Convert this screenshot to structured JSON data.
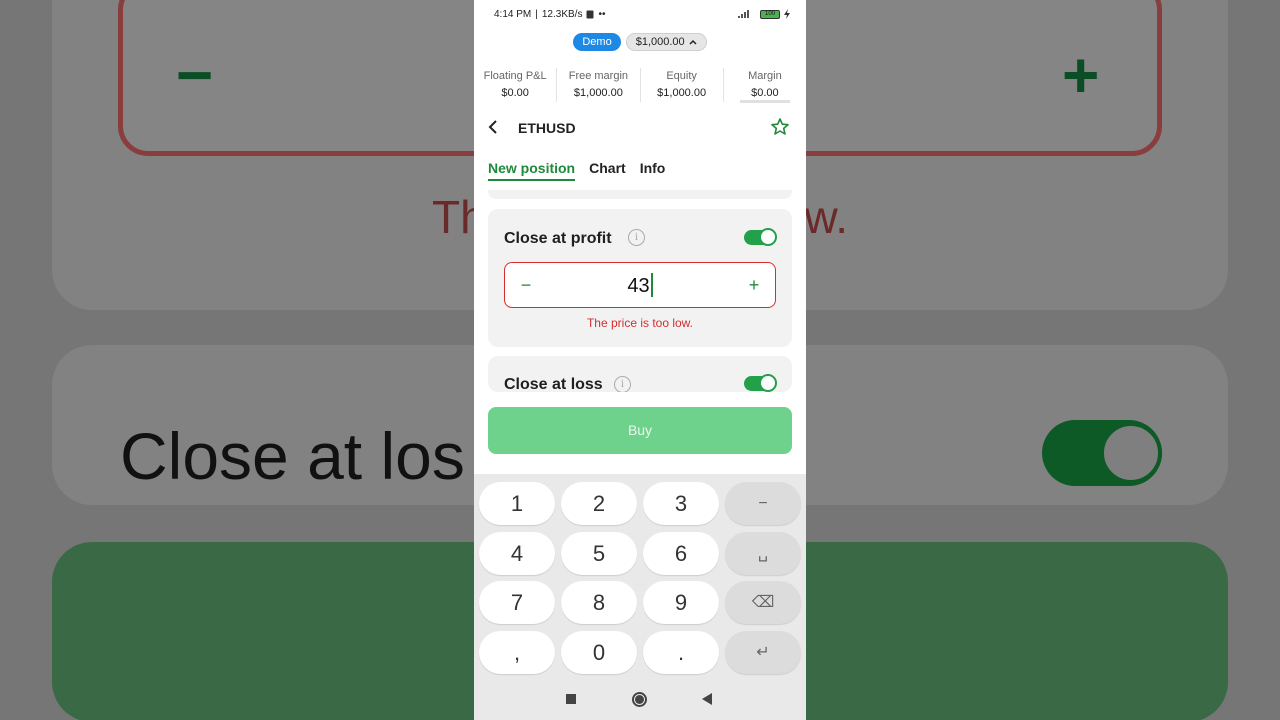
{
  "status_bar": {
    "time": "4:14 PM",
    "speed": "12.3KB/s",
    "extra": "••",
    "battery": "100"
  },
  "account": {
    "mode": "Demo",
    "balance": "$1,000.00"
  },
  "metrics": [
    {
      "label": "Floating P&L",
      "value": "$0.00"
    },
    {
      "label": "Free margin",
      "value": "$1,000.00"
    },
    {
      "label": "Equity",
      "value": "$1,000.00"
    },
    {
      "label": "Margin",
      "value": "$0.00"
    }
  ],
  "header": {
    "symbol": "ETHUSD"
  },
  "tabs": [
    {
      "label": "New position",
      "active": true
    },
    {
      "label": "Chart",
      "active": false
    },
    {
      "label": "Info",
      "active": false
    }
  ],
  "close_at_profit": {
    "title": "Close at profit",
    "enabled": true,
    "minus": "−",
    "plus": "+",
    "value": "43",
    "error": "The price is too low."
  },
  "close_at_loss": {
    "title": "Close at loss",
    "enabled": true
  },
  "buy_button": {
    "label": "Buy"
  },
  "keyboard": {
    "rows": [
      [
        "1",
        "2",
        "3",
        "−"
      ],
      [
        "4",
        "5",
        "6",
        "␣"
      ],
      [
        "7",
        "8",
        "9",
        "⌫"
      ],
      [
        ",",
        "0",
        ".",
        "↵"
      ]
    ]
  },
  "background": {
    "minus": "−",
    "plus": "+",
    "error_fragment_left": "Th",
    "error_fragment_right": "w.",
    "loss_fragment": "Close at los"
  },
  "colors": {
    "accent_green": "#1f8a3b",
    "error_red": "#d32f2f",
    "demo_blue": "#1e88e5",
    "buy_disabled_green": "#6fd28c"
  }
}
